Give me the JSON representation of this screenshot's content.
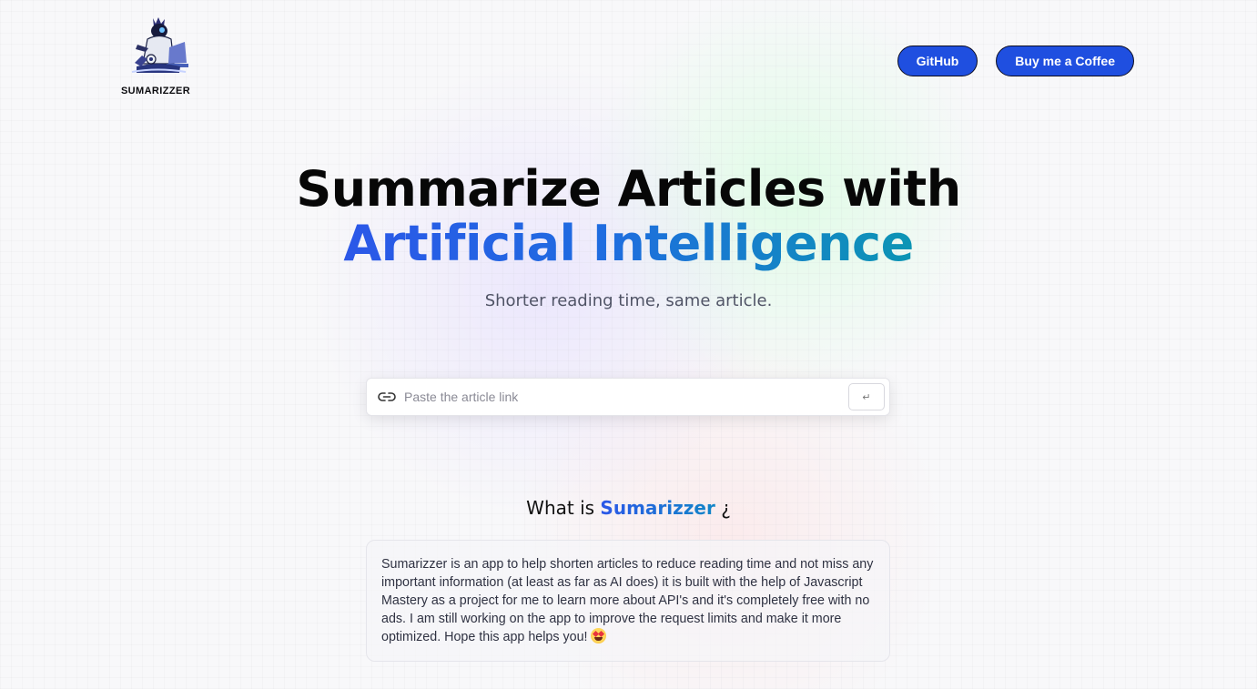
{
  "brand": {
    "name": "SUMARIZZER"
  },
  "header": {
    "buttons": [
      {
        "label": "GitHub"
      },
      {
        "label": "Buy me a Coffee"
      }
    ]
  },
  "hero": {
    "headline_line1": "Summarize Articles with",
    "headline_line2": "Artificial Intelligence",
    "subtitle": "Shorter reading time, same article.",
    "gradient_colors": [
      "#2b57e8",
      "#1f6ce0",
      "#0c95b4"
    ]
  },
  "search": {
    "placeholder": "Paste the article link",
    "value": "",
    "submit_symbol": "↵",
    "icon": "link-icon"
  },
  "about": {
    "title_prefix": "What is",
    "title_brand": "Sumarizzer",
    "title_suffix": "¿",
    "description": "Sumarizzer is an app to help shorten articles to reduce reading time and not miss any important information (at least as far as AI does) it is built with the help of Javascript Mastery as a project for me to learn more about API's and it's completely free with no ads. I am still working on the app to improve the request limits and make it more optimized. Hope this app helps you!",
    "emoji_icon": "star-struck-emoji-icon"
  },
  "colors": {
    "button_background": "#1f4fe0",
    "button_border": "#0d0d20",
    "text_dark": "#070707",
    "subtitle": "#505466"
  }
}
